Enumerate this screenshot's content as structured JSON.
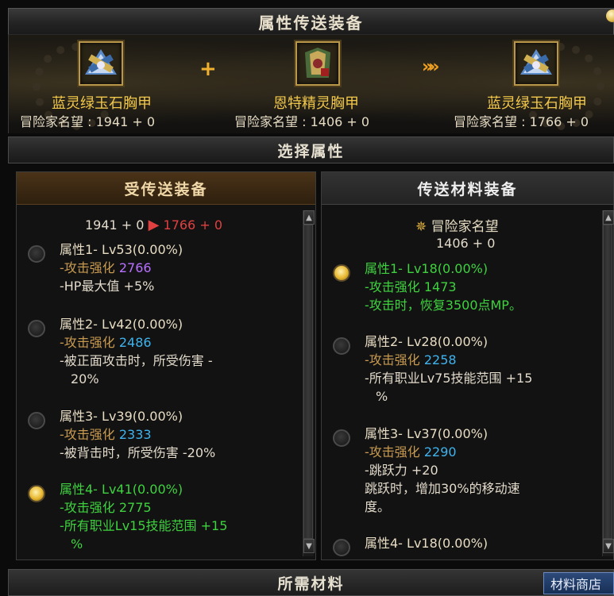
{
  "window": {
    "title": "属性传送装备"
  },
  "header": {
    "left_item": {
      "name": "蓝灵绿玉石胸甲",
      "fame_label": "冒险家名望",
      "fame_value": "1941 + 0"
    },
    "plus_symbol": "+",
    "middle_item": {
      "name": "恩特精灵胸甲",
      "fame_label": "冒险家名望",
      "fame_value": "1406 + 0"
    },
    "arrow_symbol": "»»",
    "right_item": {
      "name": "蓝灵绿玉石胸甲",
      "fame_label": "冒险家名望",
      "fame_value": "1766 + 0"
    }
  },
  "section_title": "选择属性",
  "left_panel": {
    "title": "受传送装备",
    "fame_from": "1941 + 0",
    "fame_to": "1766 + 0",
    "options": [
      {
        "title": "属性1- Lv53(0.00%)",
        "lines": [
          "-攻击强化 ",
          "-HP最大值 +5%"
        ],
        "value": "2766",
        "selected": false
      },
      {
        "title": "属性2- Lv42(0.00%)",
        "lines": [
          "-攻击强化 ",
          "-被正面攻击时，所受伤害 -",
          "20%"
        ],
        "value": "2486",
        "selected": false
      },
      {
        "title": "属性3- Lv39(0.00%)",
        "lines": [
          "-攻击强化 ",
          "-被背击时，所受伤害 -20%"
        ],
        "value": "2333",
        "selected": false
      },
      {
        "title": "属性4- Lv41(0.00%)",
        "lines": [
          "-攻击强化 ",
          "-所有职业Lv15技能范围 +15",
          "%"
        ],
        "value": "2775",
        "selected": true
      }
    ]
  },
  "right_panel": {
    "title": "传送材料装备",
    "fame_label": "冒险家名望",
    "fame_value": "1406 + 0",
    "options": [
      {
        "title": "属性1- Lv18(0.00%)",
        "lines": [
          "-攻击强化 ",
          "-攻击时，恢复3500点MP。"
        ],
        "value": "1473",
        "selected": true
      },
      {
        "title": "属性2- Lv28(0.00%)",
        "lines": [
          "-攻击强化 ",
          "-所有职业Lv75技能范围 +15",
          "%"
        ],
        "value": "2258",
        "selected": false
      },
      {
        "title": "属性3- Lv37(0.00%)",
        "lines": [
          "-攻击强化 ",
          "-跳跃力 +20",
          " 跳跃时，增加30%的移动速",
          " 度。"
        ],
        "value": "2290",
        "selected": false
      },
      {
        "title": "属性4- Lv18(0.00%)",
        "lines": [],
        "value": "",
        "selected": false
      }
    ]
  },
  "footer": {
    "title": "所需材料",
    "shop_button": "材料商店"
  },
  "colors": {
    "gold": "#f2c84a",
    "green": "#3fd23f",
    "blue": "#3fb3ee",
    "purple": "#b870ff",
    "red": "#e04040"
  }
}
